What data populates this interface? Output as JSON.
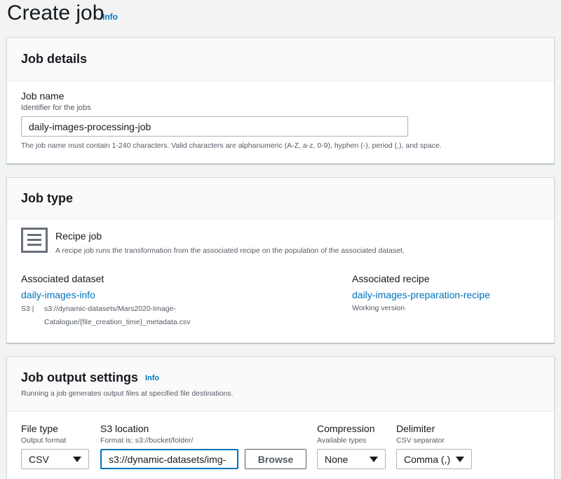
{
  "page": {
    "title": "Create job",
    "info": "Info"
  },
  "job_details": {
    "header": "Job details",
    "job_name_label": "Job name",
    "job_name_desc": "Identifier for the jobs",
    "job_name_value": "daily-images-processing-job",
    "constraint": "The job name must contain 1-240 characters. Valid characters are alphanumeric (A-Z, a-z, 0-9), hyphen (-), period (.), and space."
  },
  "job_type": {
    "header": "Job type",
    "icon": "list-icon",
    "recipe_title": "Recipe job",
    "recipe_desc": "A recipe job runs the transformation from the associated recipe on the population of the associated dataset.",
    "dataset_label": "Associated dataset",
    "dataset_link": "daily-images-info",
    "dataset_source": "S3 |",
    "dataset_path_1": "s3://dynamic-datasets/Mars2020-Image-",
    "dataset_path_2": "Catalogue/{file_creation_time}_metadata.csv",
    "recipe_label": "Associated recipe",
    "recipe_link": "daily-images-preparation-recipe",
    "recipe_version": "Working version"
  },
  "output": {
    "header": "Job output settings",
    "info": "Info",
    "desc": "Running a job generates output files at specified file destinations.",
    "file_type_label": "File type",
    "file_type_desc": "Output format",
    "file_type_value": "CSV",
    "s3_label": "S3 location",
    "s3_desc": "Format is: s3://bucket/folder/",
    "s3_value": "s3://dynamic-datasets/img-",
    "browse": "Browse",
    "compression_label": "Compression",
    "compression_desc": "Available types",
    "compression_value": "None",
    "delimiter_label": "Delimiter",
    "delimiter_desc": "CSV separator",
    "delimiter_value": "Comma (,)"
  }
}
